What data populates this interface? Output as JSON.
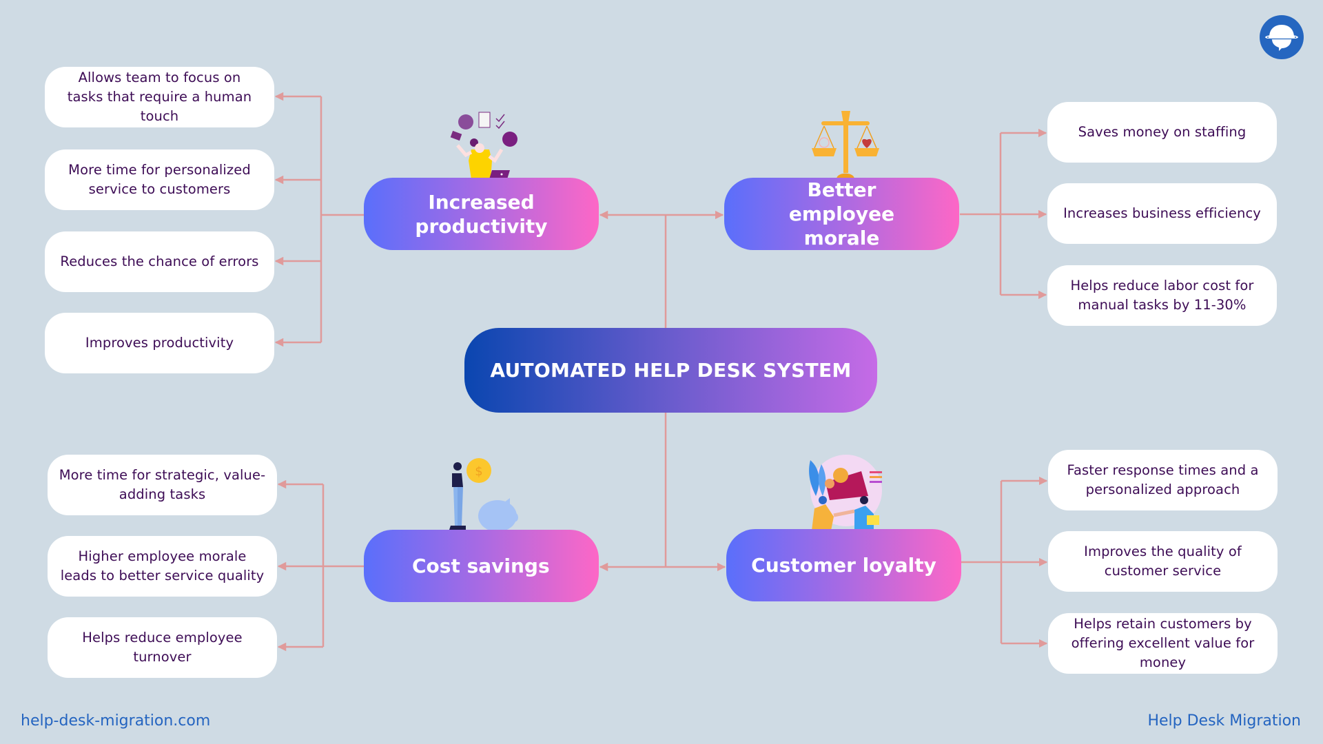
{
  "diagram": {
    "title": "AUTOMATED HELP DESK SYSTEM",
    "branches": [
      {
        "label": "Increased productivity",
        "illustration": "juggling-woman-illustration",
        "items": [
          "Allows team to focus on tasks that require a human touch",
          "More time for personalized service to customers",
          "Reduces the chance of errors",
          "Improves productivity"
        ]
      },
      {
        "label": "Better employee morale",
        "illustration": "balance-scale-illustration",
        "items": [
          "Saves money on staffing",
          "Increases business efficiency",
          "Helps reduce labor cost for manual tasks by 11-30%"
        ]
      },
      {
        "label": "Cost savings",
        "illustration": "piggy-bank-illustration",
        "items": [
          "More time for strategic, value-adding tasks",
          "Higher employee morale leads to better service quality",
          "Helps reduce employee turnover"
        ]
      },
      {
        "label": "Customer loyalty",
        "illustration": "handshake-illustration",
        "items": [
          "Faster response times and a personalized approach",
          "Improves the quality of customer service",
          "Helps retain customers by offering excellent value for money"
        ]
      }
    ]
  },
  "footer": {
    "website": "help-desk-migration.com",
    "brand": "Help Desk Migration"
  },
  "logo": {
    "icon": "planet-chat-logo-icon"
  },
  "colors": {
    "background": "#cfdbe4",
    "connector": "#e09a9a",
    "leaf_text": "#3d0c55",
    "footer_text": "#2464c0",
    "pill_gradient_start": "#5a6ffb",
    "pill_gradient_end": "#fd67c6",
    "center_gradient_start": "#0a46b0",
    "center_gradient_end": "#c66be6",
    "logo_blue": "#2566c0"
  }
}
